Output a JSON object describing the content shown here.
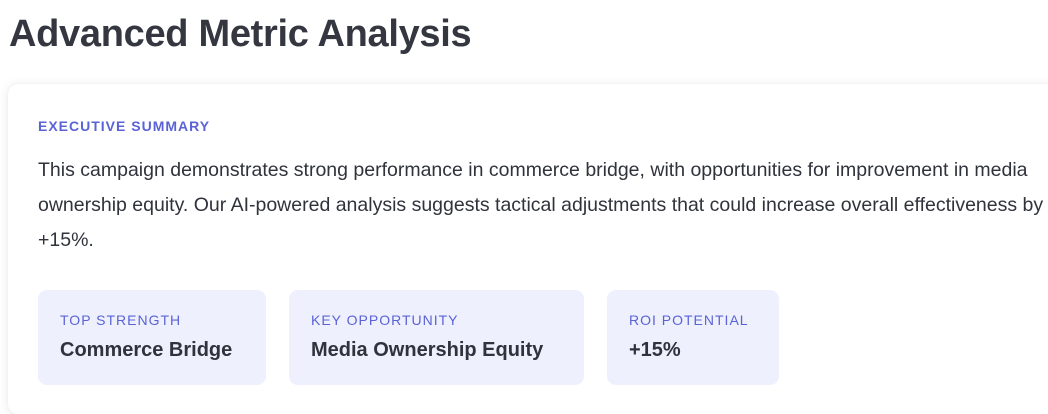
{
  "page": {
    "title": "Advanced Metric Analysis"
  },
  "summary": {
    "label": "EXECUTIVE SUMMARY",
    "text": "This campaign demonstrates strong performance in commerce bridge, with opportunities for improvement in media ownership equity. Our AI-powered analysis suggests tactical adjustments that could increase overall effectiveness by +15%."
  },
  "metrics": [
    {
      "label": "TOP STRENGTH",
      "value": "Commerce Bridge"
    },
    {
      "label": "KEY OPPORTUNITY",
      "value": "Media Ownership Equity"
    },
    {
      "label": "ROI POTENTIAL",
      "value": "+15%"
    }
  ],
  "colors": {
    "accent": "#5a63d6",
    "metric_background": "#eef0fd",
    "text": "#30333b"
  }
}
